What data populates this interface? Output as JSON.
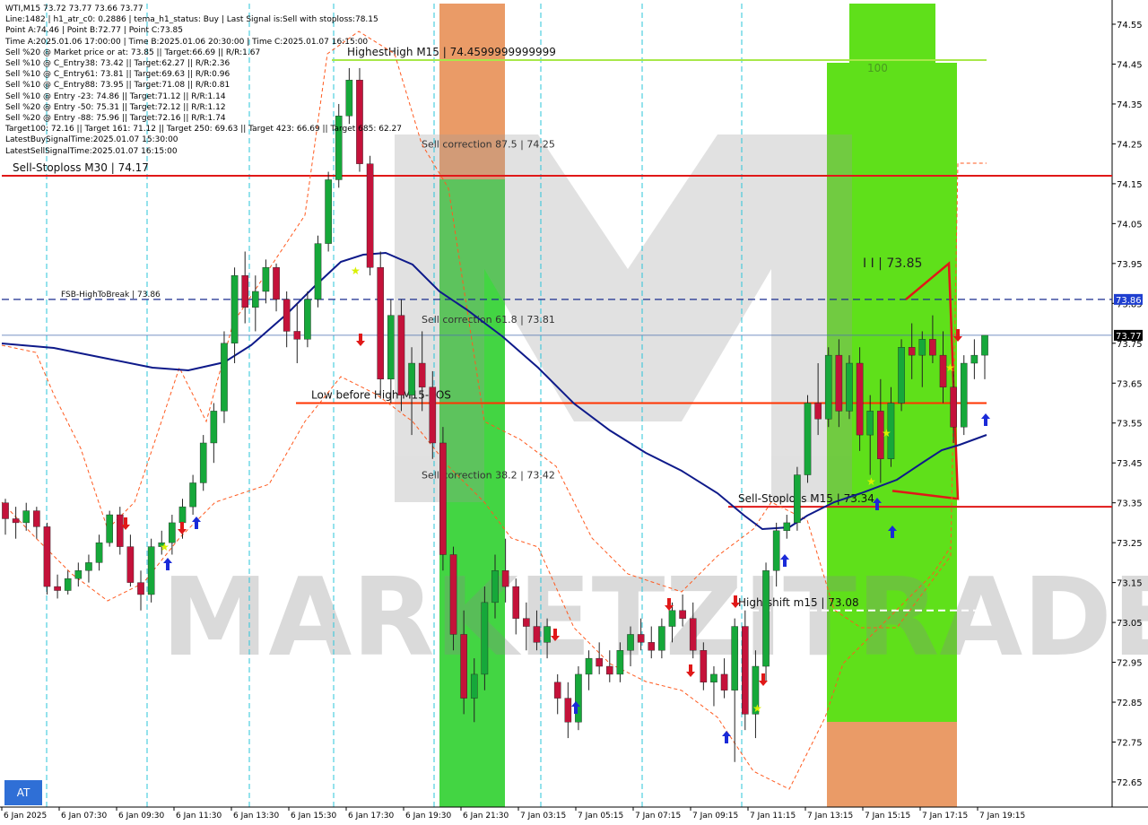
{
  "header_lines": [
    "WTI,M15  73.72 73.77 73.66 73.77",
    "Line:1482  |  h1_atr_c0: 0.2886  |  tema_h1_status: Buy  |  Last Signal is:Sell with stoploss:78.15",
    "Point A:74.46  |  Point B:72.77  |  Point C:73.85",
    "Time A:2025.01.06 17:00:00  |  Time B:2025.01.06 20:30:00  |  Time C:2025.01.07 16:15:00",
    "Sell %20 @ Market price or at: 73.85  ||  Target:66.69  ||  R/R:1.67",
    "Sell %10 @ C_Entry38: 73.42  ||  Target:62.27  ||  R/R:2.36",
    "Sell %10 @ C_Entry61: 73.81  ||  Target:69.63  ||  R/R:0.96",
    "Sell %10 @ C_Entry88: 73.95  ||  Target:71.08  ||  R/R:0.81",
    "Sell %10 @ Entry -23: 74.86  ||  Target:71.12  ||  R/R:1.14",
    "Sell %20 @ Entry -50: 75.31  ||  Target:72.12  ||  R/R:1.12",
    "Sell %20 @ Entry -88: 75.96  ||  Target:72.16  ||  R/R:1.74",
    "Target100: 72.16  ||  Target 161: 71.12  ||  Target 250: 69.63  ||  Target 423: 66.69  ||  Target 685: 62.27",
    "LatestBuySignalTime:2025.01.07 15:30:00",
    "LatestSellSignalTime:2025.01.07 16:15:00"
  ],
  "at_button": "AT",
  "watermark": "MARKETZITRADE",
  "chart_data": {
    "type": "candlestick",
    "symbol": "WTI",
    "timeframe": "M15",
    "ylim": [
      72.6,
      74.58
    ],
    "y_ticks": [
      "74.55",
      "74.45",
      "74.35",
      "74.25",
      "74.15",
      "74.05",
      "73.95",
      "73.85",
      "73.75",
      "73.65",
      "73.55",
      "73.45",
      "73.35",
      "73.25",
      "73.15",
      "73.05",
      "72.95",
      "72.85",
      "72.75",
      "72.65"
    ],
    "x_ticks": [
      "6 Jan 2025",
      "6 Jan 07:30",
      "6 Jan 09:30",
      "6 Jan 11:30",
      "6 Jan 13:30",
      "6 Jan 15:30",
      "6 Jan 17:30",
      "6 Jan 19:30",
      "6 Jan 21:30",
      "7 Jan 03:15",
      "7 Jan 05:15",
      "7 Jan 07:15",
      "7 Jan 09:15",
      "7 Jan 11:15",
      "7 Jan 13:15",
      "7 Jan 15:15",
      "7 Jan 17:15",
      "7 Jan 19:15"
    ],
    "price_badges": [
      {
        "value": 73.86,
        "label": "73.86",
        "color": "#1f3fd0"
      },
      {
        "value": 73.77,
        "label": "73.77",
        "color": "#000000"
      }
    ],
    "levels": [
      {
        "name": "HighestHigh  M15 | 74.4599999999999",
        "value": 74.46,
        "color": "#a8e84a",
        "style": "solid"
      },
      {
        "name": "Sell-Stoploss M30 | 74.17",
        "value": 74.17,
        "color": "#e01818",
        "style": "solid"
      },
      {
        "name": "FSB-HighToBreak | 73.86",
        "value": 73.86,
        "color": "#1a2d8f",
        "style": "dashed"
      },
      {
        "name": "Low before High   M15-BOS",
        "value": 73.6,
        "color": "#ff3300",
        "style": "solid"
      },
      {
        "name": "Sell-Stoploss M15 | 73.34",
        "value": 73.34,
        "color": "#e01818",
        "style": "solid"
      },
      {
        "name": "High-shift m15 | 73.08",
        "value": 73.08,
        "color": "#ffffff",
        "style": "dashed"
      }
    ],
    "zone_labels": [
      {
        "text": "Sell correction 87.5 | 74.25",
        "value": 74.25
      },
      {
        "text": "Sell correction 61.8 | 73.81",
        "value": 73.81
      },
      {
        "text": "Sell correction 38.2 | 73.42",
        "value": 73.42
      }
    ],
    "right_zone_labels": [
      {
        "text": "100",
        "value": 74.44
      },
      {
        "text": "I I | 73.85",
        "value": 73.95
      }
    ],
    "candles": [
      [
        73.35,
        73.36,
        73.27,
        73.31
      ],
      [
        73.31,
        73.34,
        73.26,
        73.3
      ],
      [
        73.3,
        73.35,
        73.28,
        73.33
      ],
      [
        73.33,
        73.34,
        73.26,
        73.29
      ],
      [
        73.29,
        73.3,
        73.12,
        73.14
      ],
      [
        73.14,
        73.17,
        73.11,
        73.13
      ],
      [
        73.13,
        73.18,
        73.12,
        73.16
      ],
      [
        73.16,
        73.2,
        73.14,
        73.18
      ],
      [
        73.18,
        73.22,
        73.15,
        73.2
      ],
      [
        73.2,
        73.27,
        73.18,
        73.25
      ],
      [
        73.25,
        73.33,
        73.24,
        73.32
      ],
      [
        73.32,
        73.34,
        73.22,
        73.24
      ],
      [
        73.24,
        73.27,
        73.14,
        73.15
      ],
      [
        73.15,
        73.18,
        73.08,
        73.12
      ],
      [
        73.12,
        73.26,
        73.1,
        73.24
      ],
      [
        73.24,
        73.28,
        73.22,
        73.25
      ],
      [
        73.25,
        73.32,
        73.22,
        73.3
      ],
      [
        73.3,
        73.36,
        73.26,
        73.34
      ],
      [
        73.34,
        73.42,
        73.32,
        73.4
      ],
      [
        73.4,
        73.52,
        73.38,
        73.5
      ],
      [
        73.5,
        73.6,
        73.45,
        73.58
      ],
      [
        73.58,
        73.78,
        73.55,
        73.75
      ],
      [
        73.75,
        73.94,
        73.7,
        73.92
      ],
      [
        73.92,
        73.98,
        73.8,
        73.84
      ],
      [
        73.84,
        73.92,
        73.78,
        73.88
      ],
      [
        73.88,
        73.96,
        73.85,
        73.94
      ],
      [
        73.94,
        73.95,
        73.83,
        73.86
      ],
      [
        73.86,
        73.88,
        73.74,
        73.78
      ],
      [
        73.78,
        73.85,
        73.7,
        73.76
      ],
      [
        73.76,
        73.88,
        73.74,
        73.86
      ],
      [
        73.86,
        74.02,
        73.84,
        74.0
      ],
      [
        74.0,
        74.18,
        73.98,
        74.16
      ],
      [
        74.16,
        74.35,
        74.14,
        74.32
      ],
      [
        74.32,
        74.44,
        74.3,
        74.41
      ],
      [
        74.41,
        74.44,
        74.18,
        74.2
      ],
      [
        74.2,
        74.22,
        73.92,
        73.94
      ],
      [
        73.94,
        73.98,
        73.62,
        73.66
      ],
      [
        73.66,
        73.86,
        73.6,
        73.82
      ],
      [
        73.82,
        73.86,
        73.58,
        73.62
      ],
      [
        73.62,
        73.74,
        73.52,
        73.7
      ],
      [
        73.7,
        73.78,
        73.58,
        73.64
      ],
      [
        73.64,
        73.68,
        73.46,
        73.5
      ],
      [
        73.5,
        73.54,
        73.18,
        73.22
      ],
      [
        73.22,
        73.24,
        72.98,
        73.02
      ],
      [
        73.02,
        73.08,
        72.82,
        72.86
      ],
      [
        72.86,
        72.96,
        72.8,
        72.92
      ],
      [
        72.92,
        73.14,
        72.88,
        73.1
      ],
      [
        73.1,
        73.22,
        73.06,
        73.18
      ],
      [
        73.18,
        73.26,
        73.1,
        73.14
      ],
      [
        73.14,
        73.16,
        73.02,
        73.06
      ],
      [
        73.06,
        73.1,
        72.98,
        73.04
      ],
      [
        73.04,
        73.08,
        72.98,
        73.0
      ],
      [
        73.0,
        73.06,
        72.96,
        73.04
      ],
      [
        72.9,
        72.92,
        72.82,
        72.86
      ],
      [
        72.86,
        72.9,
        72.76,
        72.8
      ],
      [
        72.8,
        72.94,
        72.78,
        72.92
      ],
      [
        72.92,
        72.98,
        72.88,
        72.96
      ],
      [
        72.96,
        73.0,
        72.92,
        72.94
      ],
      [
        72.94,
        72.98,
        72.9,
        72.92
      ],
      [
        72.92,
        73.0,
        72.9,
        72.98
      ],
      [
        72.98,
        73.04,
        72.94,
        73.02
      ],
      [
        73.02,
        73.06,
        72.98,
        73.0
      ],
      [
        73.0,
        73.04,
        72.96,
        72.98
      ],
      [
        72.98,
        73.06,
        72.96,
        73.04
      ],
      [
        73.04,
        73.1,
        73.0,
        73.08
      ],
      [
        73.08,
        73.12,
        73.04,
        73.06
      ],
      [
        73.06,
        73.1,
        72.96,
        72.98
      ],
      [
        72.98,
        73.0,
        72.88,
        72.9
      ],
      [
        72.9,
        72.94,
        72.84,
        72.92
      ],
      [
        72.92,
        72.96,
        72.86,
        72.88
      ],
      [
        72.88,
        73.06,
        72.7,
        73.04
      ],
      [
        73.04,
        73.08,
        72.78,
        72.82
      ],
      [
        72.82,
        72.98,
        72.76,
        72.94
      ],
      [
        72.94,
        73.2,
        72.9,
        73.18
      ],
      [
        73.18,
        73.3,
        73.14,
        73.28
      ],
      [
        73.28,
        73.32,
        73.26,
        73.3
      ],
      [
        73.3,
        73.44,
        73.28,
        73.42
      ],
      [
        73.42,
        73.62,
        73.4,
        73.6
      ],
      [
        73.6,
        73.7,
        73.52,
        73.56
      ],
      [
        73.56,
        73.74,
        73.54,
        73.72
      ],
      [
        73.72,
        73.76,
        73.54,
        73.58
      ],
      [
        73.58,
        73.72,
        73.56,
        73.7
      ],
      [
        73.7,
        73.74,
        73.48,
        73.52
      ],
      [
        73.52,
        73.62,
        73.42,
        73.58
      ],
      [
        73.58,
        73.66,
        73.4,
        73.46
      ],
      [
        73.46,
        73.64,
        73.44,
        73.6
      ],
      [
        73.6,
        73.76,
        73.58,
        73.74
      ],
      [
        73.74,
        73.8,
        73.66,
        73.72
      ],
      [
        73.72,
        73.78,
        73.64,
        73.76
      ],
      [
        73.76,
        73.82,
        73.7,
        73.72
      ],
      [
        73.72,
        73.78,
        73.6,
        73.64
      ],
      [
        73.64,
        73.68,
        73.5,
        73.54
      ],
      [
        73.54,
        73.72,
        73.52,
        73.7
      ],
      [
        73.7,
        73.76,
        73.66,
        73.72
      ],
      [
        73.72,
        73.77,
        73.66,
        73.77
      ]
    ]
  }
}
